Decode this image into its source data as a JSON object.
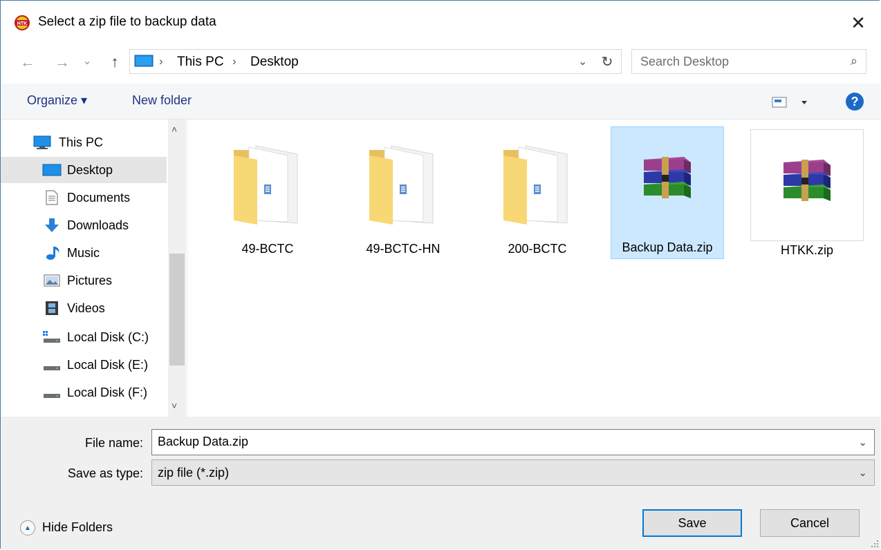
{
  "window": {
    "title": "Select a zip file to backup data",
    "close_glyph": "✕"
  },
  "nav": {
    "back_glyph": "←",
    "forward_glyph": "→",
    "recent_glyph": "⌄",
    "up_glyph": "↑",
    "breadcrumb": [
      "This PC",
      "Desktop"
    ],
    "sep_glyph": "›",
    "dropdown_glyph": "⌄",
    "refresh_glyph": "↻",
    "search_placeholder": "Search Desktop",
    "search_glyph": "⌕"
  },
  "toolbar": {
    "organize": "Organize ▾",
    "new_folder": "New folder",
    "help": "?"
  },
  "sidebar": {
    "items": [
      {
        "label": "This PC",
        "icon": "pc-icon"
      },
      {
        "label": "Desktop",
        "icon": "desktop-icon",
        "selected": true
      },
      {
        "label": "Documents",
        "icon": "documents-icon"
      },
      {
        "label": "Downloads",
        "icon": "downloads-icon"
      },
      {
        "label": "Music",
        "icon": "music-icon"
      },
      {
        "label": "Pictures",
        "icon": "pictures-icon"
      },
      {
        "label": "Videos",
        "icon": "videos-icon"
      },
      {
        "label": "Local Disk (C:)",
        "icon": "drive-c-icon"
      },
      {
        "label": "Local Disk (E:)",
        "icon": "drive-icon"
      },
      {
        "label": "Local Disk (F:)",
        "icon": "drive-icon"
      }
    ],
    "scroll_up": "˄",
    "scroll_down": "˅"
  },
  "files": [
    {
      "name": "49-BCTC",
      "type": "folder"
    },
    {
      "name": "49-BCTC-HN",
      "type": "folder"
    },
    {
      "name": "200-BCTC",
      "type": "folder"
    },
    {
      "name": "Backup Data.zip",
      "type": "zip",
      "selected": true
    },
    {
      "name": "HTKK.zip",
      "type": "zip"
    }
  ],
  "form": {
    "file_name_label": "File name:",
    "file_name_value": "Backup Data.zip",
    "save_type_label": "Save as type:",
    "save_type_value": "zip file (*.zip)",
    "dropdown_glyph": "⌄"
  },
  "footer": {
    "hide_folders": "Hide Folders",
    "hide_glyph": "▲",
    "save": "Save",
    "cancel": "Cancel"
  },
  "colors": {
    "accent": "#0078d7",
    "selection": "#cce8ff",
    "folder": "#f8d775",
    "help": "#1b6ac9"
  }
}
